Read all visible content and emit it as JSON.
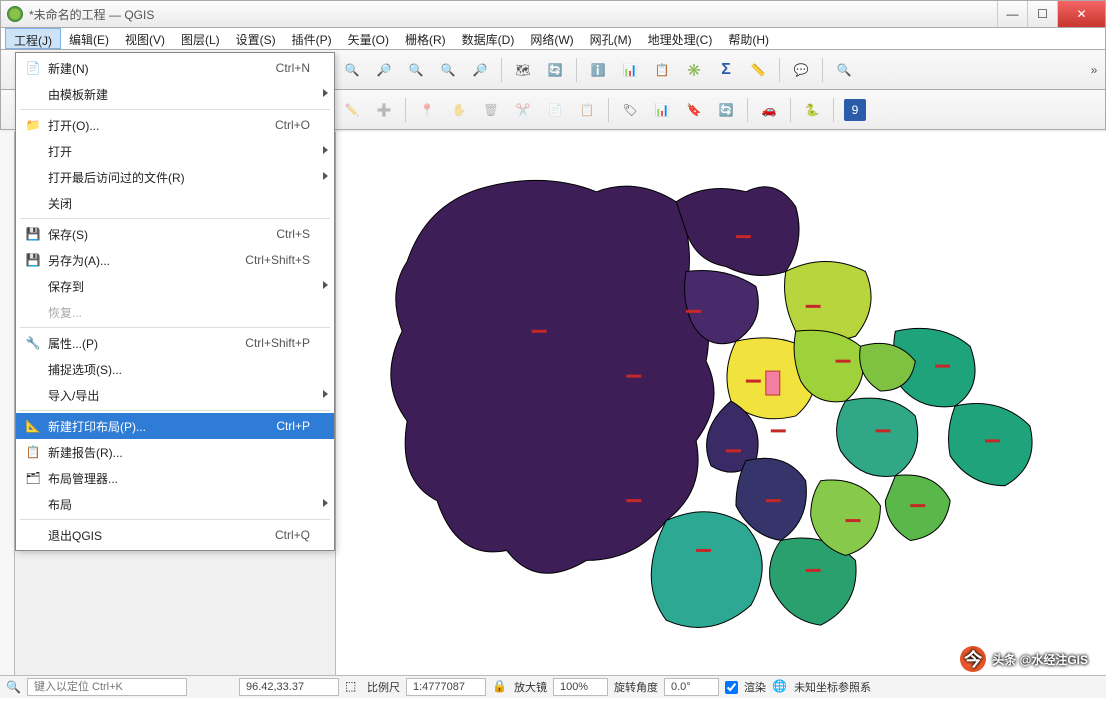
{
  "title": "*未命名的工程 — QGIS",
  "menubar": [
    {
      "label": "工程(J)",
      "active": true
    },
    {
      "label": "编辑(E)"
    },
    {
      "label": "视图(V)"
    },
    {
      "label": "图层(L)"
    },
    {
      "label": "设置(S)"
    },
    {
      "label": "插件(P)"
    },
    {
      "label": "矢量(O)"
    },
    {
      "label": "栅格(R)"
    },
    {
      "label": "数据库(D)"
    },
    {
      "label": "网络(W)"
    },
    {
      "label": "网孔(M)"
    },
    {
      "label": "地理处理(C)"
    },
    {
      "label": "帮助(H)"
    }
  ],
  "dropdown": {
    "items": [
      {
        "icon": "📄",
        "label": "新建(N)",
        "shortcut": "Ctrl+N"
      },
      {
        "label": "由模板新建",
        "submenu": true
      },
      {
        "sep": true
      },
      {
        "icon": "📁",
        "label": "打开(O)...",
        "shortcut": "Ctrl+O"
      },
      {
        "label": "打开",
        "submenu": true
      },
      {
        "label": "打开最后访问过的文件(R)",
        "submenu": true
      },
      {
        "label": "关闭"
      },
      {
        "sep": true
      },
      {
        "icon": "💾",
        "label": "保存(S)",
        "shortcut": "Ctrl+S"
      },
      {
        "icon": "💾",
        "label": "另存为(A)...",
        "shortcut": "Ctrl+Shift+S"
      },
      {
        "label": "保存到",
        "submenu": true
      },
      {
        "label": "恢复...",
        "disabled": true
      },
      {
        "sep": true
      },
      {
        "icon": "🔧",
        "label": "属性...(P)",
        "shortcut": "Ctrl+Shift+P"
      },
      {
        "label": "捕捉选项(S)..."
      },
      {
        "label": "导入/导出",
        "submenu": true
      },
      {
        "sep": true
      },
      {
        "icon": "📐",
        "label": "新建打印布局(P)...",
        "shortcut": "Ctrl+P",
        "highlight": true
      },
      {
        "icon": "📋",
        "label": "新建报告(R)..."
      },
      {
        "icon": "🗂",
        "label": "布局管理器..."
      },
      {
        "label": "布局",
        "submenu": true
      },
      {
        "sep": true
      },
      {
        "label": "退出QGIS",
        "shortcut": "Ctrl+Q"
      }
    ]
  },
  "statusbar": {
    "locator_placeholder": "键入以定位 Ctrl+K",
    "coord": "96.42,33.37",
    "scale_label": "比例尺",
    "scale_value": "1:4777087",
    "magnifier_label": "放大镜",
    "magnifier_value": "100%",
    "rotation_label": "旋转角度",
    "rotation_value": "0.0°",
    "render_label": "渲染",
    "crs_label": "未知坐标参照系"
  },
  "watermark": "头条 @水经注GIS"
}
